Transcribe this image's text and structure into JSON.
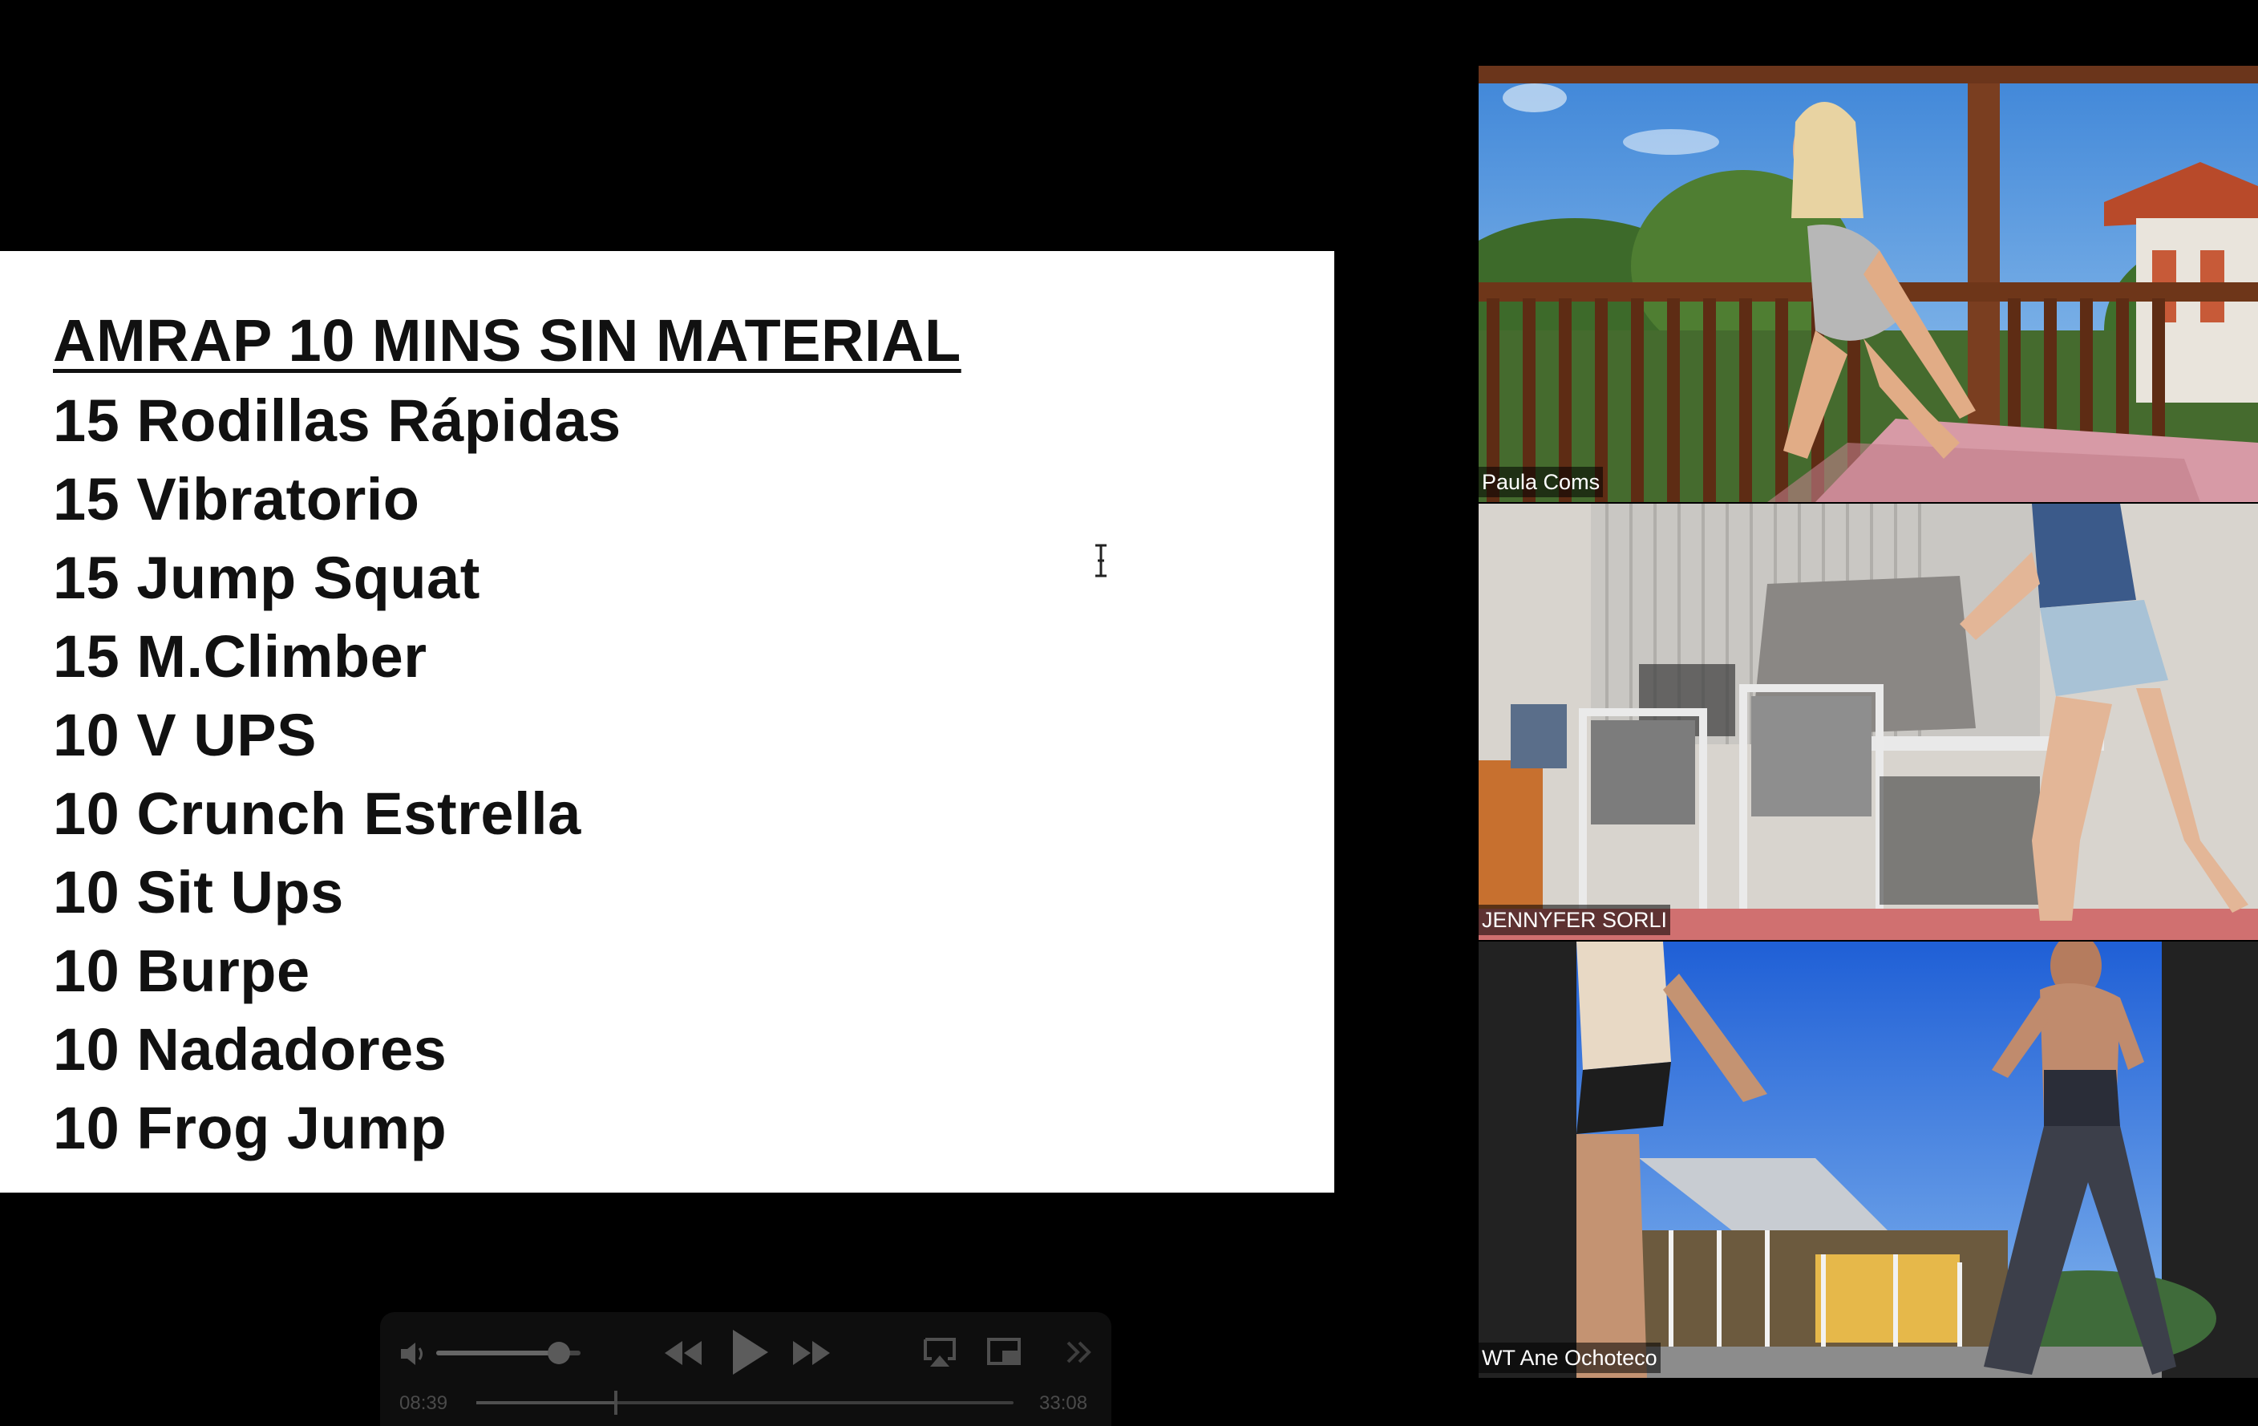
{
  "slide": {
    "title": "AMRAP 10 MINS SIN MATERIAL",
    "items": [
      "15 Rodillas Rápidas",
      "15 Vibratorio",
      "15 Jump Squat",
      "15 M.Climber",
      "10 V UPS",
      "10 Crunch Estrella",
      "10 Sit Ups",
      "10 Burpe",
      "10 Nadadores",
      "10 Frog Jump"
    ]
  },
  "participants": [
    {
      "name": "Paula Coms"
    },
    {
      "name": "JENNYFER SORLI"
    },
    {
      "name": "WT Ane Ochoteco"
    }
  ],
  "player": {
    "elapsed": "08:39",
    "duration": "33:08",
    "progress": 0.26,
    "volume": 0.85,
    "icons": {
      "volume": "volume-icon",
      "rewind": "rewind-icon",
      "play": "play-icon",
      "forward": "fast-forward-icon",
      "airplay": "airplay-icon",
      "pip": "picture-in-picture-icon",
      "more": "more-chevron-icon"
    }
  }
}
